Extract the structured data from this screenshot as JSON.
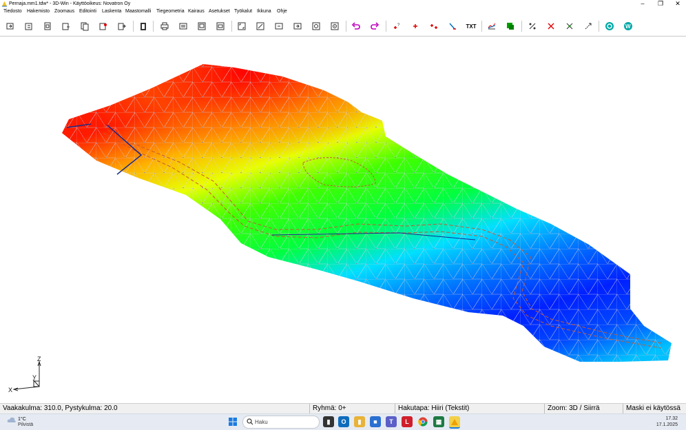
{
  "window": {
    "title": "Pernaja.mm1.tdw* - 3D-Win - Käyttöoikeus: Novatron Oy",
    "controls": [
      "minimize",
      "maximize",
      "close"
    ]
  },
  "menu": {
    "items": [
      "Tiedosto",
      "Hakemisto",
      "Zoomaus",
      "Editointi",
      "Laskenta",
      "Maastomalli",
      "Tiegeometria",
      "Kairaus",
      "Asetukset",
      "Työkalut",
      "Ikkuna",
      "Ohje"
    ]
  },
  "toolbar": {
    "text_button": "TXT",
    "icons": [
      "open-icon",
      "save-icon",
      "import-icon",
      "export-icon",
      "copy-icon",
      "convert-icon",
      "exit-icon",
      "clipboard-icon",
      "print-icon",
      "plot-icon",
      "layout-icon",
      "window-icon",
      "zoom-extents-icon",
      "zoom-window-icon",
      "zoom-previous-icon",
      "zoom-next-icon",
      "zoom-in-icon",
      "zoom-out-icon",
      "undo-icon",
      "redo-icon",
      "measure-point-icon",
      "add-point-icon",
      "move-point-icon",
      "line-icon",
      "text-icon",
      "profile-icon",
      "layer-icon",
      "calc1-icon",
      "calc2-icon",
      "calc3-icon",
      "calc4-icon",
      "help-icon",
      "web-icon"
    ],
    "undo_color": "#c000c0",
    "point_color": "#e00000"
  },
  "viewport": {
    "axis_labels": {
      "z": "Z",
      "y": "Y",
      "x": "X"
    },
    "colors": {
      "high": "#ff1a00",
      "mid_high": "#ffd400",
      "mid": "#00ff00",
      "mid_low": "#00d0ff",
      "low": "#0019ff",
      "mesh": "#c8c8d8",
      "contour": "#c85a30"
    }
  },
  "status": {
    "angles": "Vaakakulma: 310.0, Pystykulma: 20.0",
    "group": "Ryhmä: 0+",
    "search_mode": "Hakutapa: Hiiri (Tekstit)",
    "zoom": "Zoom: 3D  /  Siirrä",
    "mask": "Maski ei käytössä"
  },
  "taskbar": {
    "weather_temp": "1°C",
    "weather_cond": "Pilvistä",
    "search_placeholder": "Haku",
    "time": "17.32",
    "date": "17.1.2025",
    "apps": [
      "start-icon",
      "search-icon",
      "files-icon",
      "outlook-icon",
      "explorer-icon",
      "store-icon",
      "teams-icon",
      "l-app-icon",
      "chrome-icon",
      "sheets-icon",
      "3dwin-icon"
    ]
  }
}
